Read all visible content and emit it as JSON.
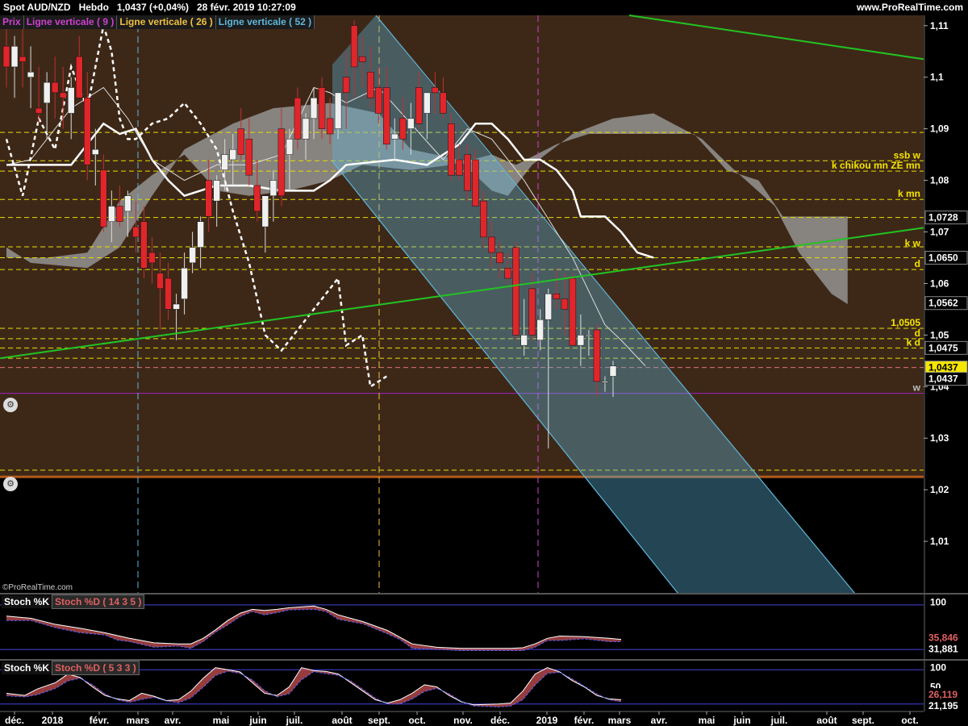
{
  "header": {
    "title": "Spot AUD/NZD",
    "period": "Hebdo",
    "price": "1,0437 (+0,04%)",
    "datetime": "28 févr. 2019 10:27:09",
    "site": "www.ProRealTime.com"
  },
  "legend": {
    "prix": "Prix",
    "lv9": "Ligne verticale ( 9 )",
    "lv26": "Ligne verticale ( 26 )",
    "lv52": "Ligne verticale ( 52 )"
  },
  "credit": "©ProRealTime.com",
  "stoch1": {
    "k_label": "Stoch %K",
    "d_label": "Stoch %D ( 14 3 5 )",
    "ticks": [
      "100"
    ],
    "k_value": "35,846",
    "d_value": "31,881"
  },
  "stoch2": {
    "k_label": "Stoch %K",
    "d_label": "Stoch %D ( 5 3 3 )",
    "ticks": [
      "100",
      "50"
    ],
    "k_value": "26,119",
    "d_value": "21,195"
  },
  "colors": {
    "up": "#f0f0f0",
    "down": "#e0262b",
    "channel": "#5fb6d9",
    "trend": "#22c422",
    "dotted": "#e8e000",
    "bg": "#3d2818"
  },
  "chart_data": {
    "type": "candlestick",
    "instrument": "Spot AUD/NZD",
    "timeframe": "weekly",
    "ylim": [
      1.0,
      1.112
    ],
    "y_ticks": [
      1.01,
      1.02,
      1.03,
      1.04,
      1.05,
      1.06,
      1.07,
      1.08,
      1.09,
      1.1,
      1.11
    ],
    "y_tick_labels": [
      "1,01",
      "1,02",
      "1,03",
      "1,04",
      "1,05",
      "1,06",
      "1,07",
      "1,08",
      "1,09",
      "1,1",
      "1,11"
    ],
    "x_labels": [
      "déc.",
      "2018",
      "févr.",
      "mars",
      "avr.",
      "mai",
      "juin",
      "juil.",
      "août",
      "sept.",
      "oct.",
      "nov.",
      "déc.",
      "2019",
      "févr.",
      "mars",
      "avr.",
      "mai",
      "juin",
      "juil.",
      "août",
      "sept.",
      "oct."
    ],
    "price_tags": [
      {
        "label": "1,0728",
        "value": 1.0728
      },
      {
        "label": "1,0650",
        "value": 1.065
      },
      {
        "label": "1,0562",
        "value": 1.0562
      },
      {
        "label": "1,0475",
        "value": 1.0475
      },
      {
        "label": "1,0437",
        "value": 1.0437,
        "highlight": true
      },
      {
        "label": "1,0437",
        "value": 1.0437
      }
    ],
    "level_labels": [
      {
        "label": "ssb w",
        "value": 1.0838
      },
      {
        "label": "k chikou mn ZE mn",
        "value": 1.0818
      },
      {
        "label": "k mn",
        "value": 1.0763
      },
      {
        "label": "k w",
        "value": 1.0667
      },
      {
        "label": "d",
        "value": 1.0627
      },
      {
        "label": "1,0505",
        "value": 1.0513
      },
      {
        "label": "d",
        "value": 1.0493
      },
      {
        "label": "k d",
        "value": 1.0475
      },
      {
        "label": "w",
        "value": 1.0387
      }
    ],
    "candles": [
      [
        1.106,
        1.112,
        1.098,
        1.102
      ],
      [
        1.102,
        1.108,
        1.096,
        1.106
      ],
      [
        1.104,
        1.11,
        1.098,
        1.103
      ],
      [
        1.1,
        1.106,
        1.094,
        1.101
      ],
      [
        1.094,
        1.102,
        1.091,
        1.093
      ],
      [
        1.095,
        1.101,
        1.088,
        1.099
      ],
      [
        1.099,
        1.104,
        1.092,
        1.097
      ],
      [
        1.097,
        1.102,
        1.09,
        1.096
      ],
      [
        1.093,
        1.1,
        1.088,
        1.098
      ],
      [
        1.104,
        1.108,
        1.096,
        1.096
      ],
      [
        1.096,
        1.101,
        1.08,
        1.083
      ],
      [
        1.085,
        1.09,
        1.079,
        1.086
      ],
      [
        1.082,
        1.085,
        1.07,
        1.071
      ],
      [
        1.072,
        1.078,
        1.068,
        1.075
      ],
      [
        1.075,
        1.079,
        1.071,
        1.072
      ],
      [
        1.074,
        1.078,
        1.069,
        1.077
      ],
      [
        1.071,
        1.076,
        1.066,
        1.069
      ],
      [
        1.072,
        1.075,
        1.061,
        1.063
      ],
      [
        1.066,
        1.069,
        1.06,
        1.064
      ],
      [
        1.062,
        1.066,
        1.051,
        1.059
      ],
      [
        1.061,
        1.064,
        1.053,
        1.055
      ],
      [
        1.055,
        1.058,
        1.049,
        1.056
      ],
      [
        1.057,
        1.066,
        1.054,
        1.063
      ],
      [
        1.064,
        1.07,
        1.062,
        1.067
      ],
      [
        1.067,
        1.073,
        1.063,
        1.072
      ],
      [
        1.08,
        1.084,
        1.07,
        1.073
      ],
      [
        1.076,
        1.081,
        1.071,
        1.08
      ],
      [
        1.082,
        1.088,
        1.078,
        1.085
      ],
      [
        1.084,
        1.089,
        1.079,
        1.086
      ],
      [
        1.09,
        1.094,
        1.084,
        1.085
      ],
      [
        1.088,
        1.092,
        1.079,
        1.081
      ],
      [
        1.079,
        1.084,
        1.072,
        1.074
      ],
      [
        1.071,
        1.077,
        1.066,
        1.077
      ],
      [
        1.077,
        1.082,
        1.072,
        1.08
      ],
      [
        1.09,
        1.094,
        1.075,
        1.077
      ],
      [
        1.085,
        1.09,
        1.078,
        1.088
      ],
      [
        1.096,
        1.098,
        1.086,
        1.088
      ],
      [
        1.088,
        1.093,
        1.084,
        1.092
      ],
      [
        1.092,
        1.098,
        1.088,
        1.096
      ],
      [
        1.098,
        1.1,
        1.088,
        1.09
      ],
      [
        1.092,
        1.096,
        1.087,
        1.089
      ],
      [
        1.09,
        1.097,
        1.088,
        1.097
      ],
      [
        1.1,
        1.105,
        1.09,
        1.097
      ],
      [
        1.11,
        1.111,
        1.096,
        1.102
      ],
      [
        1.104,
        1.108,
        1.098,
        1.103
      ],
      [
        1.101,
        1.106,
        1.094,
        1.096
      ],
      [
        1.098,
        1.102,
        1.091,
        1.093
      ],
      [
        1.098,
        1.102,
        1.086,
        1.087
      ],
      [
        1.088,
        1.092,
        1.084,
        1.089
      ],
      [
        1.092,
        1.096,
        1.086,
        1.088
      ],
      [
        1.09,
        1.095,
        1.085,
        1.092
      ],
      [
        1.098,
        1.101,
        1.09,
        1.091
      ],
      [
        1.093,
        1.097,
        1.088,
        1.097
      ],
      [
        1.098,
        1.101,
        1.093,
        1.097
      ],
      [
        1.097,
        1.1,
        1.092,
        1.093
      ],
      [
        1.091,
        1.093,
        1.08,
        1.081
      ],
      [
        1.084,
        1.087,
        1.08,
        1.081
      ],
      [
        1.085,
        1.087,
        1.076,
        1.078
      ],
      [
        1.084,
        1.086,
        1.076,
        1.075
      ],
      [
        1.076,
        1.078,
        1.067,
        1.069
      ],
      [
        1.069,
        1.072,
        1.063,
        1.066
      ],
      [
        1.066,
        1.068,
        1.061,
        1.064
      ],
      [
        1.063,
        1.066,
        1.06,
        1.061
      ],
      [
        1.067,
        1.068,
        1.049,
        1.05
      ],
      [
        1.048,
        1.057,
        1.046,
        1.05
      ],
      [
        1.059,
        1.062,
        1.049,
        1.05
      ],
      [
        1.049,
        1.055,
        1.047,
        1.053
      ],
      [
        1.053,
        1.059,
        1.028,
        1.058
      ],
      [
        1.058,
        1.063,
        1.055,
        1.057
      ],
      [
        1.057,
        1.062,
        1.05,
        1.055
      ],
      [
        1.061,
        1.062,
        1.048,
        1.048
      ],
      [
        1.048,
        1.054,
        1.044,
        1.05
      ],
      [
        1.05,
        1.051,
        1.046,
        1.05
      ],
      [
        1.051,
        1.052,
        1.038,
        1.041
      ],
      [
        1.041,
        1.042,
        1.039,
        1.041
      ],
      [
        1.042,
        1.045,
        1.038,
        1.044
      ]
    ]
  }
}
